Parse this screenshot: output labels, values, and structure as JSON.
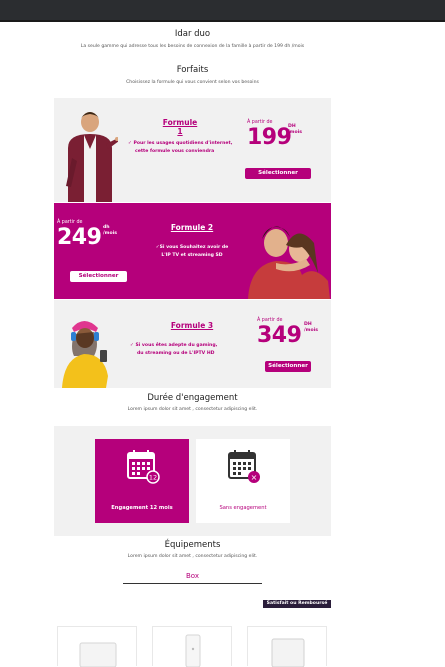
{
  "header": {
    "title": "Idar duo",
    "subtitle": "La seule gamme qui adresse tous les besoins de connexion de la famille à partir de 199 dh /mois"
  },
  "forfaits": {
    "title": "Forfaits",
    "subtitle": "Choisissez la formule qui vous convient selon vos besoins",
    "plans": [
      {
        "name": "Formule 1",
        "desc_line1": "Pour les usages quotidiens d'internet,",
        "desc_line2": "cette formule vous conviendra",
        "price_from": "À partir de",
        "price": "199",
        "unit_top": "DH",
        "unit_bottom": "/mois",
        "button": "Sélectionner"
      },
      {
        "name": "Formule 2",
        "desc_line1": "Si vous Souhaitez avoir de",
        "desc_line2": "L'IP TV et streaming SD",
        "price_from": "À partir de",
        "price": "249",
        "unit_top": "dh",
        "unit_bottom": "/mois",
        "button": "Sélectionner"
      },
      {
        "name": "Formule 3",
        "desc_line1": "Si vous êtes adepte du gaming,",
        "desc_line2": "du streaming ou de L'IPTV HD",
        "price_from": "À partir de",
        "price": "349",
        "unit_top": "DH",
        "unit_bottom": "/mois",
        "button": "Sélectionner"
      }
    ]
  },
  "engagement": {
    "title": "Durée d'engagement",
    "subtitle": "Lorem ipsum dolor sit amet , consectetur adipiscing elit.",
    "options": [
      {
        "label": "Engagement 12 mois",
        "badge": "12",
        "selected": true
      },
      {
        "label": "Sans engagement",
        "badge": "×",
        "selected": false
      }
    ]
  },
  "equipements": {
    "title": "Équipements",
    "subtitle": "Lorem ipsum dolor sit amet , consectetur adipiscing elit.",
    "tab": "Box",
    "ribbon": "Satisfait ou Remboursé"
  },
  "colors": {
    "brand": "#b5007b",
    "topbar": "#2b2d30",
    "panel": "#f1f1f1"
  }
}
